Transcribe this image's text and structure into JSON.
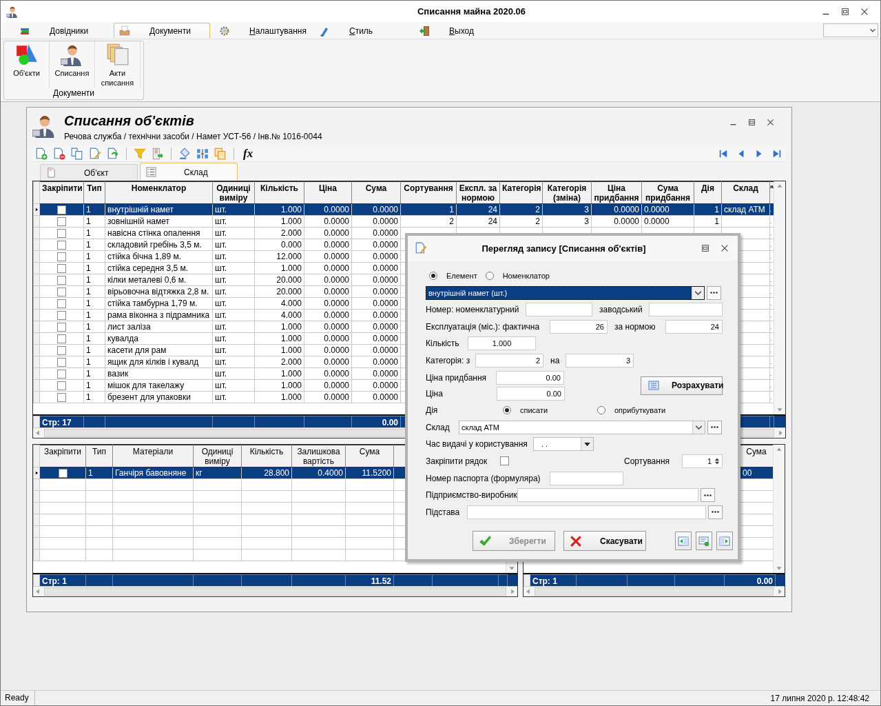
{
  "window": {
    "title": "Списання майна 2020.06"
  },
  "menu": [
    {
      "label": "Довідники",
      "selected": false
    },
    {
      "label": "Документи",
      "selected": true
    },
    {
      "label": "Налаштування",
      "selected": false
    },
    {
      "label": "Стиль",
      "selected": false
    },
    {
      "label": "Выход",
      "selected": false
    }
  ],
  "ribbon": {
    "buttons": [
      {
        "label": "Об'єкти"
      },
      {
        "label": "Списання"
      },
      {
        "label": "Акти списання"
      }
    ],
    "group": "Документи"
  },
  "document": {
    "title": "Списання об'єктів",
    "path": "Речова служба / технічни засоби / Намет УСТ-56 / Інв.№ 1016-0044",
    "toolbar_text": "fx",
    "tabs": [
      {
        "label": "Об'єкт",
        "selected": false
      },
      {
        "label": "Склад",
        "selected": true
      }
    ]
  },
  "main_table": {
    "columns": [
      {
        "label": "Закріпити"
      },
      {
        "label": "Тип"
      },
      {
        "label": "Номенклатор"
      },
      {
        "label": "Одиниці виміру"
      },
      {
        "label": "Кількість"
      },
      {
        "label": "Ціна"
      },
      {
        "label": "Сума"
      },
      {
        "label": "Сортування"
      },
      {
        "label": "Експл. за нормою"
      },
      {
        "label": "Категорія"
      },
      {
        "label": "Категорія (зміна)"
      },
      {
        "label": "Ціна придбання"
      },
      {
        "label": "Сума придбання"
      },
      {
        "label": "Дія"
      },
      {
        "label": "Склад"
      },
      {
        "label": "а"
      }
    ],
    "rows": [
      {
        "selected": true,
        "pinned": false,
        "type": "1",
        "name": "внутрішній намет",
        "unit": "шт.",
        "qty": "1.000",
        "price": "0.0000",
        "sum": "0.0000",
        "sort": "1",
        "norm": "24",
        "cat": "2",
        "cat_new": "3",
        "buy_price": "0.0000",
        "buy_sum": "0.0000",
        "action": "1",
        "store": "склад АТМ",
        "column_16": "."
      },
      {
        "selected": false,
        "pinned": false,
        "type": "1",
        "name": "зовнішній намет",
        "unit": "шт.",
        "qty": "1.000",
        "price": "0.0000",
        "sum": "0.0000",
        "sort": "2",
        "norm": "24",
        "cat": "2",
        "cat_new": "3",
        "buy_price": "0.0000",
        "buy_sum": "0.0000",
        "action": "1",
        "column_16": "."
      },
      {
        "selected": false,
        "pinned": false,
        "type": "1",
        "name": "навісна стінка опалення",
        "unit": "шт.",
        "qty": "2.000",
        "price": "0.0000",
        "sum": "0.0000",
        "column_16": "."
      },
      {
        "selected": false,
        "pinned": false,
        "type": "1",
        "name": "складовий гребінь 3,5 м.",
        "unit": "шт.",
        "qty": "0.000",
        "price": "0.0000",
        "sum": "0.0000",
        "column_16": "."
      },
      {
        "selected": false,
        "pinned": false,
        "type": "1",
        "name": "стійка бічна 1,89 м.",
        "unit": "шт.",
        "qty": "12.000",
        "price": "0.0000",
        "sum": "0.0000",
        "column_16": "."
      },
      {
        "selected": false,
        "pinned": false,
        "type": "1",
        "name": "стійка середня 3,5 м.",
        "unit": "шт.",
        "qty": "1.000",
        "price": "0.0000",
        "sum": "0.0000",
        "column_16": "."
      },
      {
        "selected": false,
        "pinned": false,
        "type": "1",
        "name": "кілки металеві 0,6 м.",
        "unit": "шт.",
        "qty": "20.000",
        "price": "0.0000",
        "sum": "0.0000",
        "column_16": "."
      },
      {
        "selected": false,
        "pinned": false,
        "type": "1",
        "name": "вірьовочна відтяжка 2,8 м.",
        "unit": "шт.",
        "qty": "20.000",
        "price": "0.0000",
        "sum": "0.0000",
        "column_16": "."
      },
      {
        "selected": false,
        "pinned": false,
        "type": "1",
        "name": "стійка тамбурна 1,79 м.",
        "unit": "шт.",
        "qty": "4.000",
        "price": "0.0000",
        "sum": "0.0000",
        "column_16": "."
      },
      {
        "selected": false,
        "pinned": false,
        "type": "1",
        "name": "рама віконна з підрамника",
        "unit": "шт.",
        "qty": "4.000",
        "price": "0.0000",
        "sum": "0.0000",
        "column_16": "."
      },
      {
        "selected": false,
        "pinned": false,
        "type": "1",
        "name": "лист заліза",
        "unit": "шт.",
        "qty": "1.000",
        "price": "0.0000",
        "sum": "0.0000",
        "column_16": "."
      },
      {
        "selected": false,
        "pinned": false,
        "type": "1",
        "name": "кувалда",
        "unit": "шт.",
        "qty": "1.000",
        "price": "0.0000",
        "sum": "0.0000",
        "column_16": "."
      },
      {
        "selected": false,
        "pinned": false,
        "type": "1",
        "name": "касети для рам",
        "unit": "шт.",
        "qty": "1.000",
        "price": "0.0000",
        "sum": "0.0000",
        "column_16": "."
      },
      {
        "selected": false,
        "pinned": false,
        "type": "1",
        "name": "ящик для кілків і кувалд",
        "unit": "шт.",
        "qty": "2.000",
        "price": "0.0000",
        "sum": "0.0000",
        "column_16": "."
      },
      {
        "selected": false,
        "pinned": false,
        "type": "1",
        "name": "вазик",
        "unit": "шт.",
        "qty": "1.000",
        "price": "0.0000",
        "sum": "0.0000",
        "column_16": "."
      },
      {
        "selected": false,
        "pinned": false,
        "type": "1",
        "name": "мішок для такелажу",
        "unit": "шт.",
        "qty": "1.000",
        "price": "0.0000",
        "sum": "0.0000",
        "column_16": "."
      },
      {
        "selected": false,
        "pinned": false,
        "type": "1",
        "name": "брезент для упаковки",
        "unit": "шт.",
        "qty": "1.000",
        "price": "0.0000",
        "sum": "0.0000",
        "column_16": "."
      }
    ],
    "footer": {
      "pinned": "Стр: 17",
      "sum": "0.00"
    }
  },
  "materials_table": {
    "columns": [
      {
        "label": "Закріпити"
      },
      {
        "label": "Тип"
      },
      {
        "label": "Матеріали"
      },
      {
        "label": "Одиниці виміру"
      },
      {
        "label": "Кількість"
      },
      {
        "label": "Залишкова вартість"
      },
      {
        "label": "Сума"
      }
    ],
    "rows": [
      {
        "selected": true,
        "pinned": false,
        "type": "1",
        "name": "Ганчіря бавовняне",
        "unit": "кг",
        "qty": "28.800",
        "residual": "0.4000",
        "sum": "11.5200"
      }
    ],
    "footer": {
      "pinned": "Стр: 1",
      "sum": "11.52"
    }
  },
  "side_table": {
    "columns": [
      {
        "label": "Сума"
      }
    ],
    "rows": [
      {
        "selected": true,
        "column_5": "00"
      }
    ],
    "footer": {
      "column_1": "Стр: 1",
      "column_5": "0.00"
    }
  },
  "dialog": {
    "title": "Перегляд запису [Списання об'єктів]",
    "source": [
      {
        "label": "Елемент",
        "selected": true
      },
      {
        "label": "Номенклатор",
        "selected": false
      }
    ],
    "item": "внутрішній намет (шт.)",
    "number_label": "Номер: номенклатурний",
    "factory_label": "заводський",
    "usage_label": "Експлуатація (міс.): фактична",
    "usage_actual": "26",
    "norm_label": "за нормою",
    "usage_norm": "24",
    "qty_label": "Кількість",
    "qty": "1.000",
    "cat_label": "Категорія: з",
    "cat_from": "2",
    "cat_to_label": "на",
    "cat_to": "3",
    "purchase_label": "Ціна придбання",
    "purchase": "0.00",
    "price_label": "Ціна",
    "price": "0.00",
    "calc_button": "Розрахувати",
    "action_label": "Дія",
    "actions": [
      {
        "label": "списати",
        "selected": true
      },
      {
        "label": "оприбуткувати",
        "selected": false
      }
    ],
    "store_label": "Склад",
    "store": "склад АТМ",
    "issue_label": "Час видачі у користування",
    "issue_date": ". .",
    "pin_label": "Закріпити рядок",
    "pin_checked": false,
    "sort_label": "Сортування",
    "sort": "1",
    "passport_label": "Номер паспорта (формуляра)",
    "maker_label": "Підприємство-виробник",
    "basis_label": "Підстава",
    "save_button": {
      "label": "Зберегти",
      "disabled": true
    },
    "cancel_button": "Скасувати"
  },
  "status_bar": {
    "text": "Ready",
    "datetime": "17 липня 2020 р. 12:48:42"
  }
}
